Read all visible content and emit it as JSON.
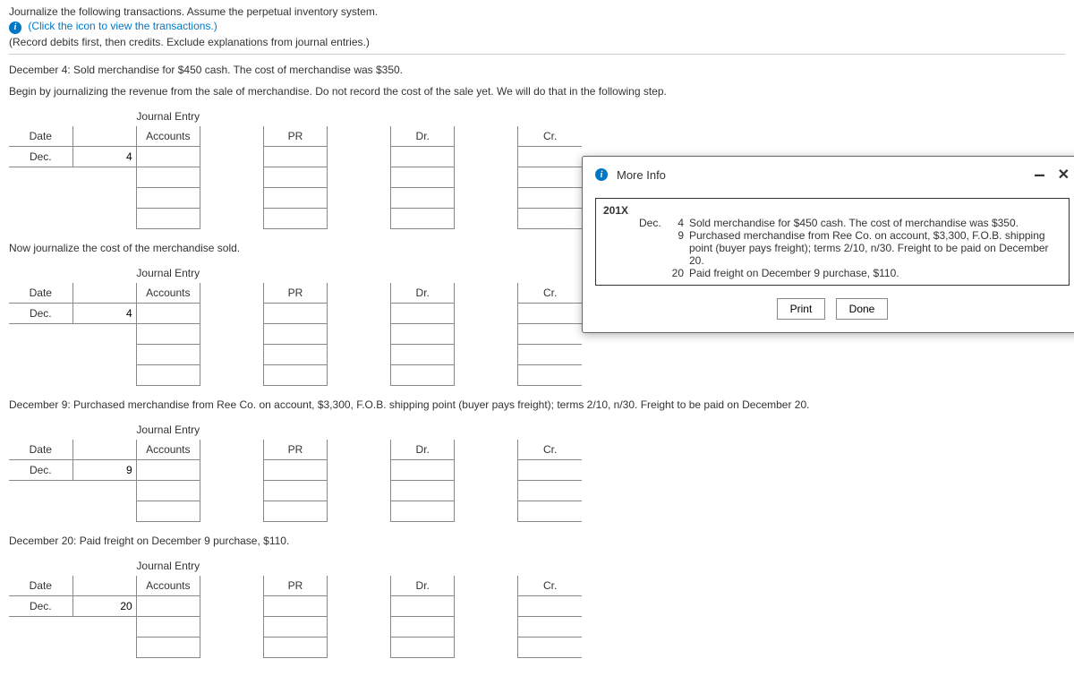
{
  "instructions": {
    "line1": "Journalize the following transactions. Assume the perpetual inventory system.",
    "link": "(Click the icon to view the transactions.)",
    "line2": "(Record debits first, then credits. Exclude explanations from journal entries.)"
  },
  "steps": {
    "s1a": "December 4: Sold merchandise for $450 cash. The cost of merchandise was $350.",
    "s1b": "Begin by journalizing the revenue from the sale of merchandise. Do not record the cost of the sale yet. We will do that in the following step.",
    "s2": "Now journalize the cost of the merchandise sold.",
    "s3": "December 9: Purchased merchandise from Ree Co. on account, $3,300, F.O.B. shipping point (buyer pays freight); terms 2/10, n/30. Freight to be paid on December 20.",
    "s4": "December 20: Paid freight on December 9 purchase, $110."
  },
  "je_labels": {
    "title": "Journal Entry",
    "date": "Date",
    "accounts": "Accounts",
    "pr": "PR",
    "dr": "Dr.",
    "cr": "Cr.",
    "month": "Dec."
  },
  "entries": [
    {
      "day": "4"
    },
    {
      "day": "4"
    },
    {
      "day": "9"
    },
    {
      "day": "20"
    }
  ],
  "modal": {
    "title": "More Info",
    "year": "201X",
    "month": "Dec.",
    "transactions": [
      {
        "day": "4",
        "desc": "Sold merchandise for $450 cash. The cost of merchandise was $350."
      },
      {
        "day": "9",
        "desc": "Purchased merchandise from Ree Co. on account, $3,300, F.O.B. shipping point (buyer pays freight); terms 2/10, n/30. Freight to be paid on December 20."
      },
      {
        "day": "20",
        "desc": "Paid freight on December 9 purchase, $110."
      }
    ],
    "print": "Print",
    "done": "Done"
  }
}
